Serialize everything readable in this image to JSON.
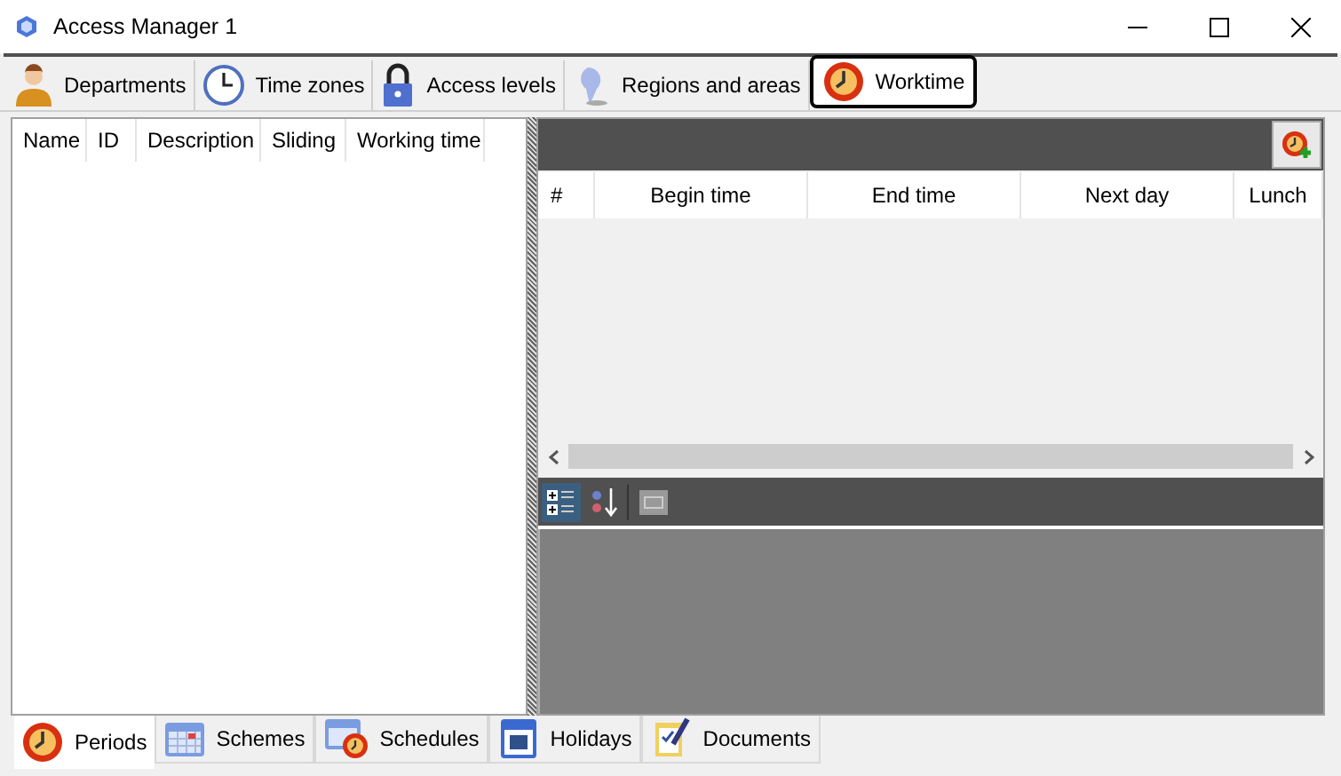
{
  "window": {
    "title": "Access Manager 1"
  },
  "top_tabs": [
    {
      "label": "Departments",
      "selected": false
    },
    {
      "label": "Time zones",
      "selected": false
    },
    {
      "label": "Access levels",
      "selected": false
    },
    {
      "label": "Regions and areas",
      "selected": false
    },
    {
      "label": "Worktime",
      "selected": true
    }
  ],
  "periods_table": {
    "columns": [
      "Name",
      "ID",
      "Description",
      "Sliding",
      "Working time"
    ]
  },
  "intervals_table": {
    "columns": [
      "#",
      "Begin time",
      "End time",
      "Next day",
      "Lunch"
    ]
  },
  "bottom_tabs": [
    {
      "label": "Periods",
      "selected": true
    },
    {
      "label": "Schemes",
      "selected": false
    },
    {
      "label": "Schedules",
      "selected": false
    },
    {
      "label": "Holidays",
      "selected": false
    },
    {
      "label": "Documents",
      "selected": false
    }
  ]
}
